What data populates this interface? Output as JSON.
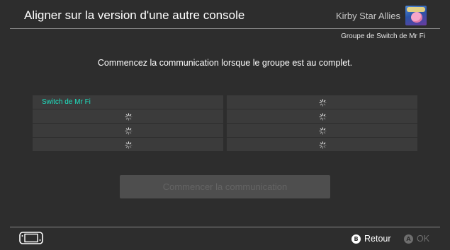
{
  "header": {
    "title": "Aligner sur la version d'une autre console",
    "game_title": "Kirby Star Allies"
  },
  "group": {
    "name": "Groupe de Switch de Mr Fi"
  },
  "instruction": "Commencez la communication lorsque le groupe est au complet.",
  "slots": {
    "left": [
      {
        "label": "Switch de Mr Fi",
        "status": "connected"
      },
      {
        "label": "",
        "status": "searching"
      },
      {
        "label": "",
        "status": "searching"
      },
      {
        "label": "",
        "status": "searching"
      }
    ],
    "right": [
      {
        "label": "",
        "status": "searching"
      },
      {
        "label": "",
        "status": "searching"
      },
      {
        "label": "",
        "status": "searching"
      },
      {
        "label": "",
        "status": "searching"
      }
    ]
  },
  "start_button": {
    "label": "Commencer la communication",
    "enabled": false
  },
  "footer": {
    "back": {
      "glyph": "B",
      "label": "Retour"
    },
    "ok": {
      "glyph": "A",
      "label": "OK"
    }
  },
  "colors": {
    "background": "#2d2d2d",
    "player_accent": "#1fe0c0",
    "slot_background": "#3b3b3b",
    "disabled_button": "#4e4e4e"
  },
  "icons": {
    "slot_pending": "loading-spinner-icon",
    "controller": "joy-con-console-icon"
  }
}
